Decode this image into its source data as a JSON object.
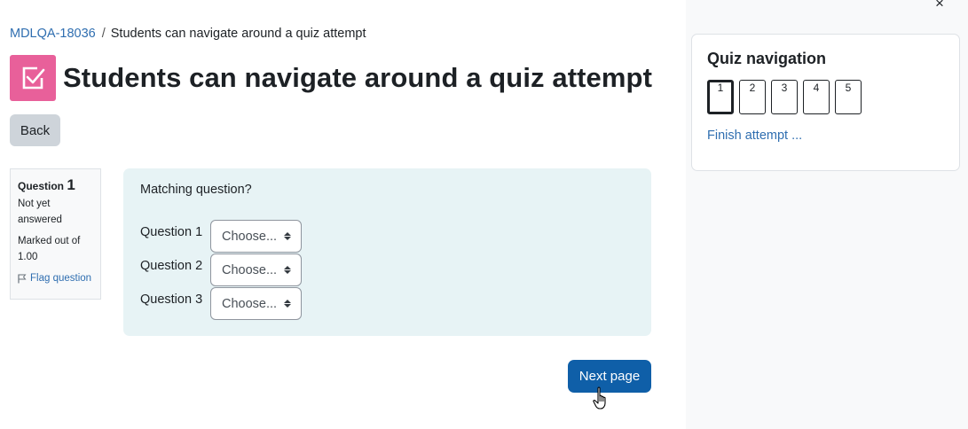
{
  "breadcrumb": {
    "course": "MDLQA-18036",
    "separator": "/",
    "current": "Students can navigate around a quiz attempt"
  },
  "header": {
    "title": "Students can navigate around a quiz attempt",
    "icon": "quiz-checkbox-icon",
    "icon_color": "#e8609a"
  },
  "back_label": "Back",
  "question_info": {
    "label": "Question",
    "number": "1",
    "state": "Not yet answered",
    "marks": "Marked out of 1.00",
    "flag_label": "Flag question"
  },
  "question": {
    "text": "Matching question?",
    "rows": [
      {
        "label": "Question 1",
        "selected": "Choose..."
      },
      {
        "label": "Question 2",
        "selected": "Choose..."
      },
      {
        "label": "Question 3",
        "selected": "Choose..."
      }
    ]
  },
  "next_label": "Next page",
  "drawer": {
    "close": "×",
    "nav_title": "Quiz navigation",
    "nav_buttons": [
      "1",
      "2",
      "3",
      "4",
      "5"
    ],
    "current_question": "1",
    "finish_label": "Finish attempt ..."
  },
  "colors": {
    "primary": "#0f5fa8",
    "link": "#2f6eb0",
    "question_bg": "#e7f3f5"
  }
}
